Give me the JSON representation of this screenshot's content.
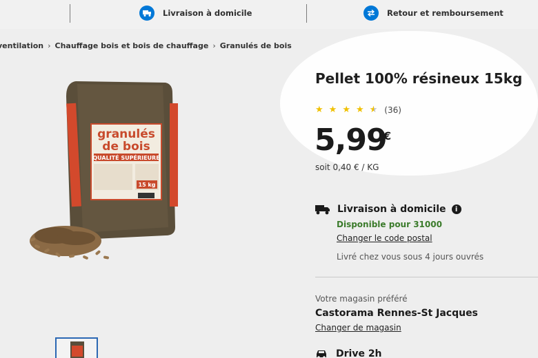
{
  "topbar": {
    "delivery_label": "Livraison à domicile",
    "return_label": "Retour et remboursement"
  },
  "breadcrumb": {
    "items": [
      "ventilation",
      "Chauffage bois et bois de chauffage",
      "Granulés de bois"
    ]
  },
  "product_image": {
    "brand_text": "granulés de bois",
    "quality_text": "QUALITÉ SUPÉRIEURE",
    "weight_text": "15 kg"
  },
  "product": {
    "title": "Pellet 100% résineux 15kg",
    "rating_stars": 4.5,
    "rating_count": "(36)",
    "price": "5,99",
    "currency": "€",
    "unit_price": "soit 0,40 € / KG"
  },
  "delivery": {
    "label": "Livraison à domicile",
    "info_icon": "i",
    "availability": "Disponible pour 31000",
    "change_postal": "Changer le code postal",
    "delivered_text": "Livré chez vous sous 4 jours ouvrés"
  },
  "store": {
    "label": "Votre magasin préféré",
    "name": "Castorama Rennes-St Jacques",
    "change_link": "Changer de magasin"
  },
  "drive": {
    "label": "Drive 2h"
  },
  "colors": {
    "accent": "#0078d7",
    "available": "#3b7b2b",
    "stars": "#f0c000"
  }
}
